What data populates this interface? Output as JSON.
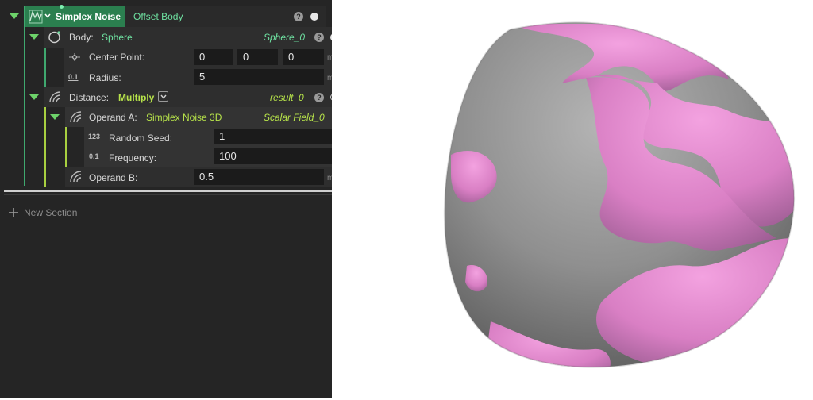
{
  "root": {
    "title": "Simplex Noise",
    "subtitle": "Offset Body"
  },
  "body": {
    "label": "Body:",
    "type": "Sphere",
    "output": "Sphere_0"
  },
  "center_point": {
    "label": "Center Point:",
    "x": "0",
    "y": "0",
    "z": "0",
    "unit": "mm"
  },
  "radius": {
    "label": "Radius:",
    "value": "5",
    "unit": "mm"
  },
  "distance": {
    "label": "Distance:",
    "op": "Multiply",
    "output": "result_0"
  },
  "operand_a": {
    "label": "Operand A:",
    "type": "Simplex Noise 3D",
    "output": "Scalar Field_0"
  },
  "random_seed": {
    "label": "Random Seed:",
    "value": "1"
  },
  "frequency": {
    "label": "Frequency:",
    "value": "100"
  },
  "operand_b": {
    "label": "Operand B:",
    "value": "0.5",
    "unit": "mm"
  },
  "new_section": {
    "label": "New Section"
  },
  "colors": {
    "panel_bg": "#252525",
    "accent_green": "#2e8b57",
    "lime": "#b7e34a",
    "noise_pink": "#e48bd0",
    "sphere_gray": "#8f8f8f"
  }
}
